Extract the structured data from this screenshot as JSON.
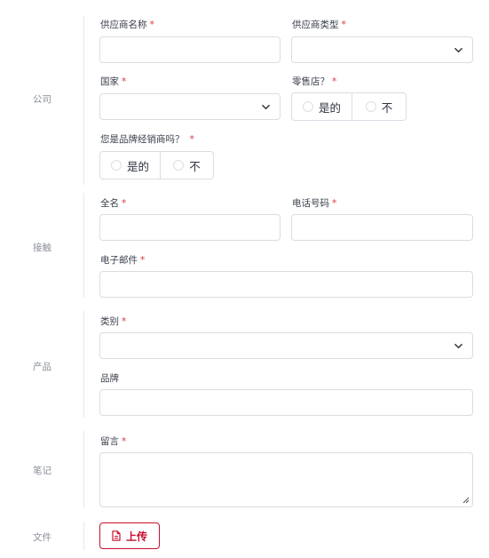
{
  "sections": {
    "company": "公司",
    "contact": "接触",
    "product": "产品",
    "notes": "笔记",
    "files": "文件"
  },
  "required_mark": "*",
  "company": {
    "supplier_name_label": "供应商名称",
    "supplier_type_label": "供应商类型",
    "country_label": "国家",
    "retail_label": "零售店？",
    "retail_yes": "是的",
    "retail_no": "不",
    "brand_distributor_label": "您是品牌经销商吗？",
    "brand_yes": "是的",
    "brand_no": "不"
  },
  "contact": {
    "full_name_label": "全名",
    "phone_label": "电话号码",
    "email_label": "电子邮件"
  },
  "product": {
    "category_label": "类别",
    "brand_label": "品牌"
  },
  "notes": {
    "message_label": "留言"
  },
  "files": {
    "upload_label": "上传",
    "upload_icon": "file-icon"
  },
  "colors": {
    "accent": "#c8102e",
    "required": "#dc3545",
    "border": "#d9dde3"
  }
}
